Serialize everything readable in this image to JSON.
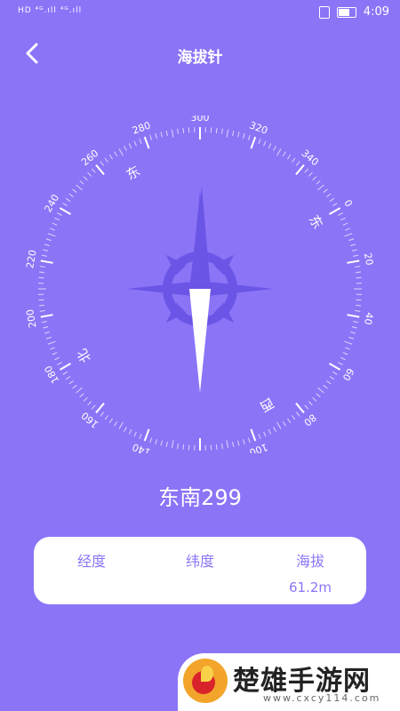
{
  "status_bar": {
    "left_text": "HD ⁴ᴳ.ıll ⁴ᴳ.ıll",
    "time": "4:09"
  },
  "header": {
    "title": "海拔针"
  },
  "compass": {
    "ticks": [
      "0",
      "20",
      "40",
      "60",
      "80",
      "100",
      "120",
      "140",
      "160",
      "180",
      "200",
      "220",
      "240",
      "260",
      "280",
      "300",
      "320",
      "340"
    ],
    "directions": [
      {
        "label": "东",
        "deg": 0
      },
      {
        "label": "西",
        "deg": 90
      },
      {
        "label": "北",
        "deg": 180
      },
      {
        "label": "东",
        "deg": 270
      }
    ],
    "rotation": 60,
    "accent": "#6a55e6",
    "needle_dark": "#6a55e6",
    "needle_light": "#ffffff"
  },
  "heading": {
    "text": "东南299"
  },
  "info": {
    "longitude_label": "经度",
    "longitude_value": "",
    "latitude_label": "纬度",
    "latitude_value": "",
    "altitude_label": "海拔",
    "altitude_value": "61.2m"
  },
  "ad": {
    "brand": "楚雄手游网",
    "url": "www.cxcy114.com"
  },
  "colors": {
    "background": "#8c74f7",
    "card": "#ffffff",
    "text_accent": "#8c74f7"
  }
}
